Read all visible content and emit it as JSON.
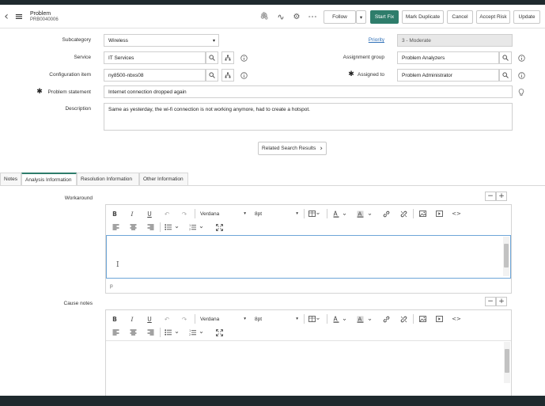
{
  "header": {
    "record_type": "Problem",
    "record_number": "PRB0040006",
    "buttons": {
      "follow": "Follow",
      "start_fix": "Start Fix",
      "mark_duplicate": "Mark Duplicate",
      "cancel": "Cancel",
      "accept_risk": "Accept Risk",
      "update": "Update"
    },
    "icons": {
      "back": "‹",
      "menu": "≡",
      "attachment": "🖇",
      "activity": "∿",
      "settings": "⚙",
      "more": "∘∘∘",
      "dropdown": "▾"
    }
  },
  "form": {
    "subcategory": {
      "label": "Subcategory",
      "value": "Wireless"
    },
    "service": {
      "label": "Service",
      "value": "IT Services"
    },
    "configuration_item": {
      "label": "Configuration item",
      "value": "ny8500-nbxs08"
    },
    "problem_statement": {
      "label": "Problem statement",
      "value": "Internet connection dropped again",
      "required_mark": "✱"
    },
    "description": {
      "label": "Description",
      "value": "Same as yesterday, the wi-fi connection is not working anymore, had to create a hotspot."
    },
    "priority": {
      "label": "Priority",
      "value": "3 - Moderate"
    },
    "assignment_group": {
      "label": "Assignment group",
      "value": "Problem Analyzers"
    },
    "assigned_to": {
      "label": "Assigned to",
      "value": "Problem Administrator",
      "required_mark": "✱"
    }
  },
  "related_search": {
    "label": "Related Search Results",
    "chevron": "›"
  },
  "tabs": [
    {
      "label": "Notes"
    },
    {
      "label": "Analysis Information"
    },
    {
      "label": "Resolution Information"
    },
    {
      "label": "Other Information"
    }
  ],
  "workaround": {
    "label": "Workaround",
    "font": "Verdana",
    "size": "8pt",
    "footer": "p"
  },
  "cause_notes": {
    "label": "Cause notes",
    "font": "Verdana",
    "size": "8pt"
  },
  "editor_icons": {
    "bold": "B",
    "italic": "I",
    "underline": "U",
    "undo": "↶",
    "redo": "↷",
    "minus": "−",
    "plus": "+",
    "cursor": "I"
  },
  "colors": {
    "accent": "#2e7d6b",
    "link": "#2e6fb7",
    "required": "#222222",
    "frame": "#1f2a2e"
  }
}
